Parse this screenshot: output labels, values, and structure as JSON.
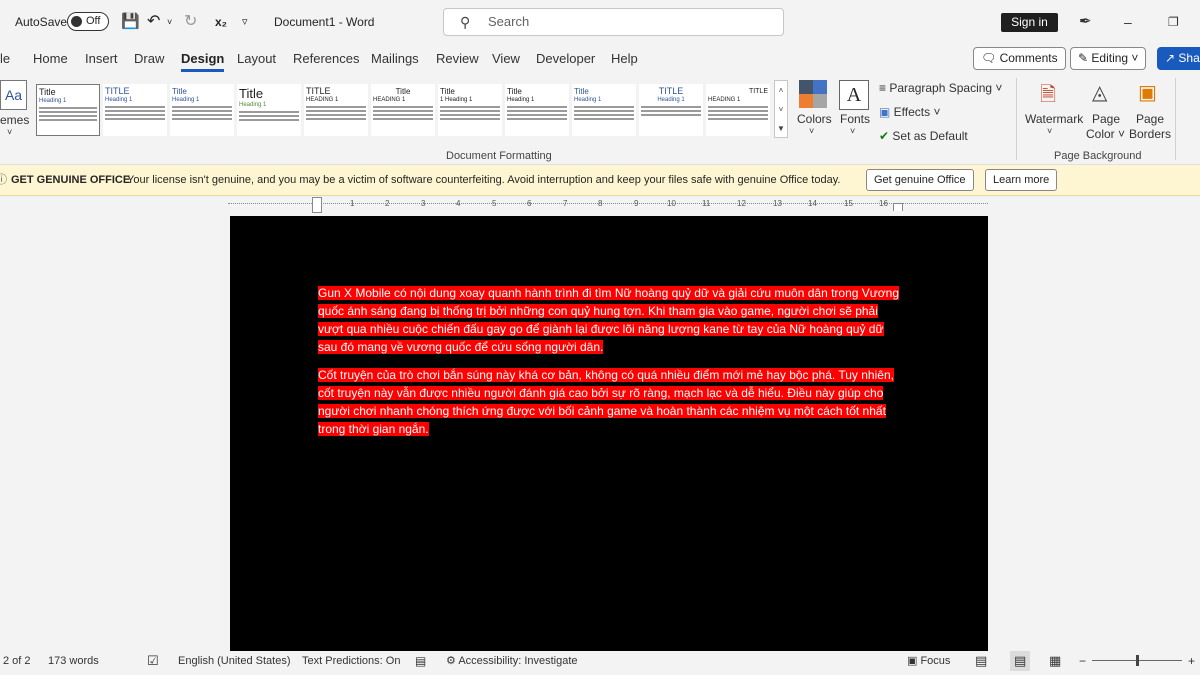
{
  "titlebar": {
    "autosave_label": "AutoSave",
    "toggle_state": "Off",
    "subscript_icon": "x₂",
    "doc_title": "Document1 - Word",
    "search_placeholder": "Search",
    "signin_label": "Sign in"
  },
  "tabs": [
    "le",
    "Home",
    "Insert",
    "Draw",
    "Design",
    "Layout",
    "References",
    "Mailings",
    "Review",
    "View",
    "Developer",
    "Help"
  ],
  "active_tab": "Design",
  "ribbon_right": {
    "comments": "Comments",
    "editing": "Editing",
    "share": "Share"
  },
  "ribbon": {
    "themes_label": "emes",
    "themes_icon_text": "Aa",
    "gallery": [
      {
        "title": "Title",
        "heading": "Heading 1"
      },
      {
        "title": "TITLE",
        "heading": "Heading 1"
      },
      {
        "title": "Title",
        "heading": "Heading 1"
      },
      {
        "title": "Title",
        "heading": "Heading 1"
      },
      {
        "title": "TITLE",
        "heading": "HEADING 1"
      },
      {
        "title": "Title",
        "heading": "HEADING 1"
      },
      {
        "title": "Title",
        "heading": "1 Heading 1"
      },
      {
        "title": "Title",
        "heading": "Heading 1"
      },
      {
        "title": "Title",
        "heading": "Heading 1"
      },
      {
        "title": "TITLE",
        "heading": "Heading 1"
      },
      {
        "title": "TITLE",
        "heading": "HEADING 1"
      }
    ],
    "colors_label": "Colors",
    "fonts_label": "Fonts",
    "fonts_icon_text": "A",
    "paragraph_spacing": "Paragraph Spacing",
    "effects": "Effects",
    "set_default": "Set as Default",
    "document_formatting": "Document Formatting",
    "watermark": "Watermark",
    "page_color_1": "Page",
    "page_color_2": "Color",
    "page_borders_1": "Page",
    "page_borders_2": "Borders",
    "page_background": "Page Background"
  },
  "business_bar": {
    "title": "GET GENUINE OFFICE",
    "message": "Your license isn't genuine, and you may be a victim of software counterfeiting. Avoid interruption and keep your files safe with genuine Office today.",
    "primary_button": "Get genuine Office",
    "secondary_button": "Learn more"
  },
  "ruler": [
    "1",
    "2",
    "3",
    "4",
    "5",
    "6",
    "7",
    "8",
    "9",
    "10",
    "11",
    "12",
    "13",
    "14",
    "15",
    "16"
  ],
  "document": {
    "paragraph1": "Gun X Mobile có nội dung xoay quanh hành trình đi tìm Nữ hoàng quỷ dữ và giải cứu muôn dân trong Vương quốc ánh sáng đang bị thống trị bởi những con quỷ hung tợn. Khi tham gia vào game, người chơi sẽ phải vượt qua nhiều cuộc chiến đấu gay go để giành lại được lõi năng lượng kane từ tay của Nữ hoàng quỷ dữ sau đó mang về vương quốc để cứu sống người dân.",
    "paragraph2": "Cốt truyện của trò chơi bắn súng này khá cơ bản, không có quá nhiều điểm mới mẻ hay bộc phá. Tuy nhiên, cốt truyện này vẫn được nhiều người đánh giá cao bởi sự rõ ràng, mạch lạc và dễ hiểu. Điều này giúp cho người chơi nhanh chóng thích ứng được với bối cảnh game và hoàn thành các nhiệm vụ một cách tốt nhất trong thời gian ngắn.",
    "highlight_color": "#ff0000",
    "page_color": "#000000"
  },
  "status": {
    "page": "2 of 2",
    "words": "173 words",
    "language": "English (United States)",
    "text_predictions": "Text Predictions: On",
    "accessibility": "Accessibility: Investigate",
    "focus": "Focus",
    "zoom_minus": "−",
    "zoom_plus": "+"
  },
  "accent_color": "#185abd"
}
